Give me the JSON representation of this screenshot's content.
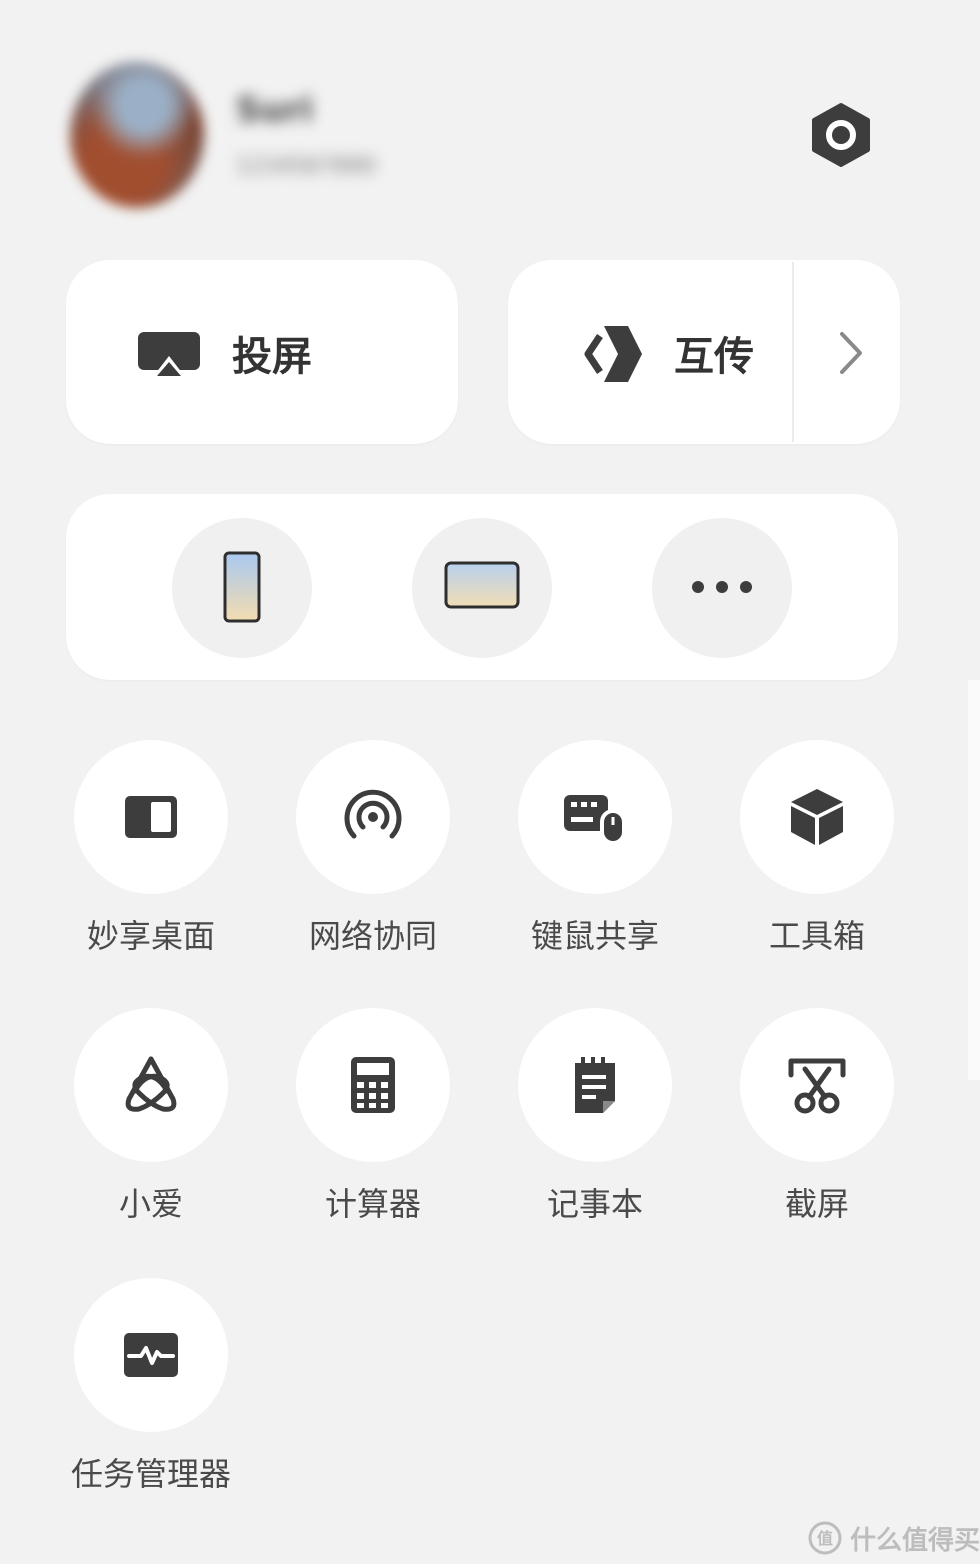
{
  "profile": {
    "name": "Suri",
    "subtitle": "1234567890"
  },
  "cards": {
    "cast_label": "投屏",
    "transfer_label": "互传"
  },
  "devices": [
    {
      "icon": "phone-icon"
    },
    {
      "icon": "tablet-icon"
    },
    {
      "icon": "more-icon"
    }
  ],
  "tools": [
    {
      "label": "妙享桌面",
      "icon": "desktop-share-icon"
    },
    {
      "label": "网络协同",
      "icon": "network-sync-icon"
    },
    {
      "label": "键鼠共享",
      "icon": "keyboard-mouse-icon"
    },
    {
      "label": "工具箱",
      "icon": "toolbox-icon"
    },
    {
      "label": "小爱",
      "icon": "xiaoai-icon"
    },
    {
      "label": "计算器",
      "icon": "calculator-icon"
    },
    {
      "label": "记事本",
      "icon": "notepad-icon"
    },
    {
      "label": "截屏",
      "icon": "screenshot-icon"
    },
    {
      "label": "任务管理器",
      "icon": "task-manager-icon"
    }
  ],
  "watermark": {
    "text": "什么值得买"
  },
  "colors": {
    "background": "#f2f2f2",
    "card": "#ffffff",
    "icon": "#3d3d3d",
    "label": "#4a4a4a"
  }
}
